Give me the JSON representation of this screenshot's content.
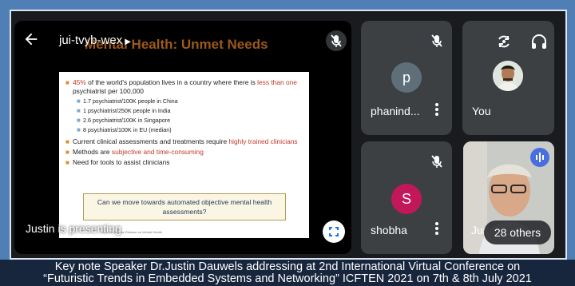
{
  "meeting": {
    "code": "jui-tvyb-wex",
    "presenting_label": "Justin is presenting"
  },
  "slide": {
    "title": "Mental Health: Unmet Needs",
    "bullet1_pre": "45%",
    "bullet1_mid": " of the world's population lives in a country where there is ",
    "bullet1_red": "less than one",
    "bullet1_post": " psychiatrist per 100,000",
    "sub1": "1.7 psychiatrist/100K people in China",
    "sub2": "1 psychiatrist/250K people in India",
    "sub3": "2.6 psychiatrist/100K in Singapore",
    "sub4": "8 psychiatrist/100K in EU (median)",
    "bullet2_pre": "Current clinical assessments and treatments require ",
    "bullet2_red": "highly trained clinicians",
    "bullet3_pre": "Methods are ",
    "bullet3_red": "subjective and time-consuming",
    "bullet4": "Need for tools to assist clinicians",
    "question": "Can we move towards automated objective mental health assessments?",
    "footnote": "2016 NUS Press Release on Mental Health"
  },
  "participants": [
    {
      "name": "phanind...",
      "initial": "p",
      "avatar_color": "#5f6f7a"
    },
    {
      "name": "You"
    },
    {
      "name": "shobha",
      "initial": "S",
      "avatar_color": "#c2185b"
    },
    {
      "name": "Jus"
    }
  ],
  "others_count_label": "28 others",
  "caption": {
    "line1": "Key note Speaker Dr.Justin Dauwels addressing at 2nd International Virtual Conference on",
    "line2": "“Futuristic Trends in Embedded Systems and Networking” ICFTEN 2021 on 7th & 8th July 2021"
  },
  "colors": {
    "accent_blue": "#4a6ee0",
    "tile_gray": "#3c4043",
    "slide_orange": "#e28a2a",
    "slide_red": "#c0392b"
  }
}
